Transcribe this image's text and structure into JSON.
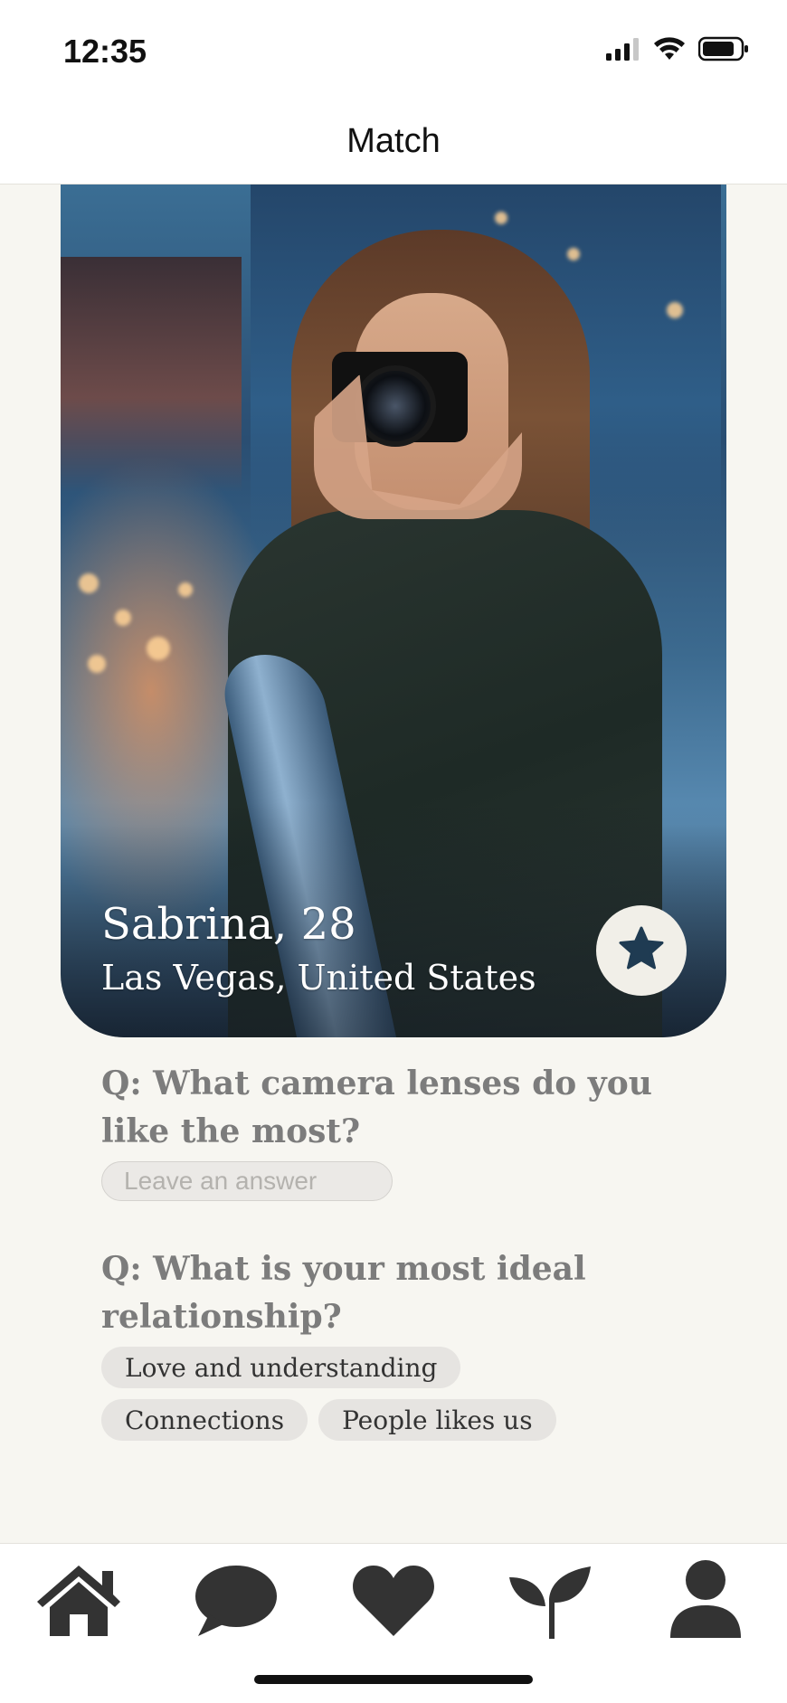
{
  "status_bar": {
    "time": "12:35",
    "icons": [
      "signal-icon",
      "wifi-icon",
      "battery-icon"
    ]
  },
  "header": {
    "title": "Match"
  },
  "profile": {
    "name_age": "Sabrina, 28",
    "location": "Las Vegas, United States",
    "favorite_icon": "star-icon"
  },
  "questions": [
    {
      "question": "Q: What camera lenses do you like the most?",
      "input_placeholder": "Leave an answer",
      "input_value": ""
    },
    {
      "question": "Q: What is your most ideal relationship?",
      "answers": [
        "Love and understanding",
        "Connections",
        "People likes us"
      ]
    }
  ],
  "tab_bar": {
    "tabs": [
      {
        "name": "home",
        "icon": "home-icon"
      },
      {
        "name": "messages",
        "icon": "chat-bubble-icon"
      },
      {
        "name": "likes",
        "icon": "heart-icon"
      },
      {
        "name": "growth",
        "icon": "sprout-icon"
      },
      {
        "name": "profile",
        "icon": "person-icon"
      }
    ]
  },
  "colors": {
    "background": "#f7f6f1",
    "question_text": "#7c7c7c",
    "chip_bg": "#e6e4e1",
    "icon_dark": "#333333",
    "star_fill": "#1f3b52"
  }
}
